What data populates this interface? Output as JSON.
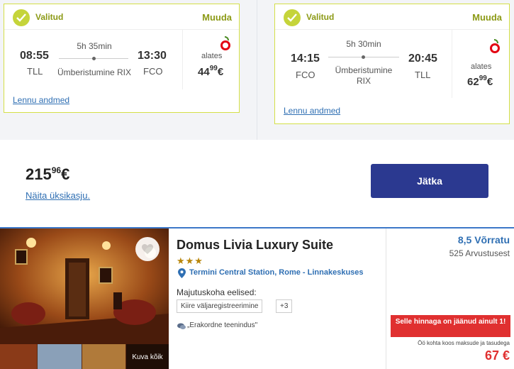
{
  "flights": [
    {
      "status": "Valitud",
      "change": "Muuda",
      "depart_time": "08:55",
      "depart_code": "TLL",
      "duration": "5h 35min",
      "stopover": "Ümberistumine RIX",
      "arrive_time": "13:30",
      "arrive_code": "FCO",
      "from_label": "alates",
      "price_main": "44",
      "price_cents": "99",
      "currency": "€",
      "details": "Lennu andmed"
    },
    {
      "status": "Valitud",
      "change": "Muuda",
      "depart_time": "14:15",
      "depart_code": "FCO",
      "duration": "5h 30min",
      "stopover_line1": "Ümberistumine",
      "stopover_line2": "RIX",
      "arrive_time": "20:45",
      "arrive_code": "TLL",
      "from_label": "alates",
      "price_main": "62",
      "price_cents": "99",
      "currency": "€",
      "details": "Lennu andmed"
    }
  ],
  "total": {
    "main": "215",
    "cents": "96",
    "currency": "€",
    "breakdown": "Näita üksikasju.",
    "continue": "Jätka"
  },
  "hotel": {
    "name": "Domus Livia Luxury Suite",
    "stars": "★★★",
    "location": "Termini Central Station, Rome - Linnakeskuses",
    "amenities_title": "Majutuskoha eelised:",
    "amenities": [
      "Kiire väljaregistreerimine",
      "+3"
    ],
    "quote": "„Erakordne teenindus\"",
    "see_all": "Kuva kõik",
    "rating": "8,5 Võrratu",
    "reviews": "525 Arvustusest",
    "scarcity": "Selle hinnaga on jäänud ainult 1!",
    "tax_note": "Öö kohta koos maksude ja tasudega",
    "price": "67",
    "currency": "€"
  },
  "colors": {
    "accent_green": "#c5d43a",
    "brand_blue": "#2b3990",
    "link_blue": "#2f6fb3",
    "alert_red": "#e03030"
  }
}
